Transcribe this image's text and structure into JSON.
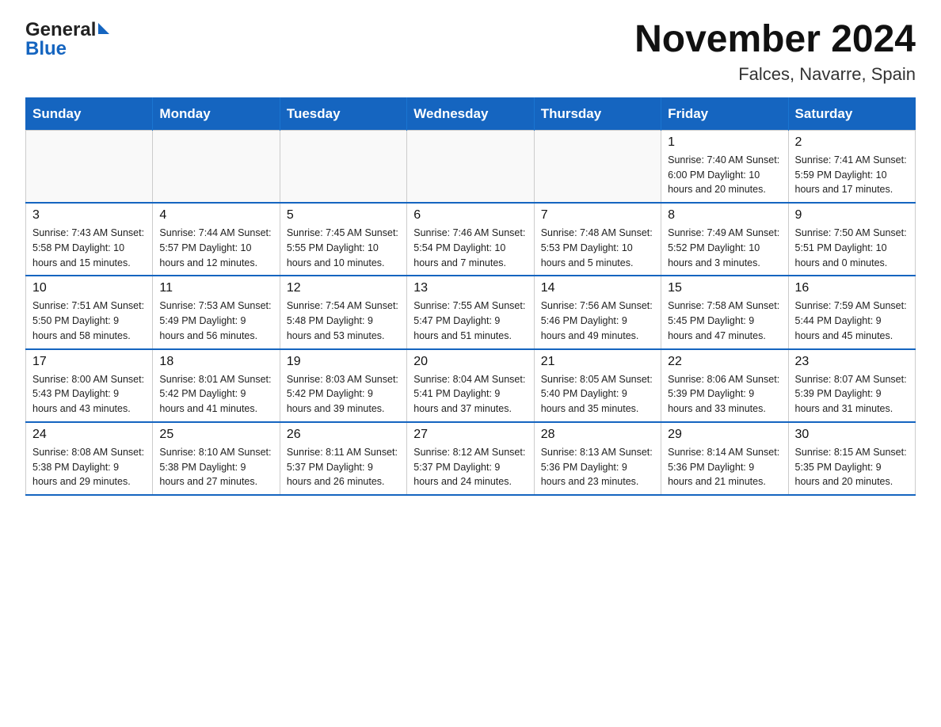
{
  "header": {
    "title": "November 2024",
    "subtitle": "Falces, Navarre, Spain",
    "logo_general": "General",
    "logo_blue": "Blue"
  },
  "calendar": {
    "days_of_week": [
      "Sunday",
      "Monday",
      "Tuesday",
      "Wednesday",
      "Thursday",
      "Friday",
      "Saturday"
    ],
    "weeks": [
      [
        {
          "day": "",
          "info": ""
        },
        {
          "day": "",
          "info": ""
        },
        {
          "day": "",
          "info": ""
        },
        {
          "day": "",
          "info": ""
        },
        {
          "day": "",
          "info": ""
        },
        {
          "day": "1",
          "info": "Sunrise: 7:40 AM\nSunset: 6:00 PM\nDaylight: 10 hours\nand 20 minutes."
        },
        {
          "day": "2",
          "info": "Sunrise: 7:41 AM\nSunset: 5:59 PM\nDaylight: 10 hours\nand 17 minutes."
        }
      ],
      [
        {
          "day": "3",
          "info": "Sunrise: 7:43 AM\nSunset: 5:58 PM\nDaylight: 10 hours\nand 15 minutes."
        },
        {
          "day": "4",
          "info": "Sunrise: 7:44 AM\nSunset: 5:57 PM\nDaylight: 10 hours\nand 12 minutes."
        },
        {
          "day": "5",
          "info": "Sunrise: 7:45 AM\nSunset: 5:55 PM\nDaylight: 10 hours\nand 10 minutes."
        },
        {
          "day": "6",
          "info": "Sunrise: 7:46 AM\nSunset: 5:54 PM\nDaylight: 10 hours\nand 7 minutes."
        },
        {
          "day": "7",
          "info": "Sunrise: 7:48 AM\nSunset: 5:53 PM\nDaylight: 10 hours\nand 5 minutes."
        },
        {
          "day": "8",
          "info": "Sunrise: 7:49 AM\nSunset: 5:52 PM\nDaylight: 10 hours\nand 3 minutes."
        },
        {
          "day": "9",
          "info": "Sunrise: 7:50 AM\nSunset: 5:51 PM\nDaylight: 10 hours\nand 0 minutes."
        }
      ],
      [
        {
          "day": "10",
          "info": "Sunrise: 7:51 AM\nSunset: 5:50 PM\nDaylight: 9 hours\nand 58 minutes."
        },
        {
          "day": "11",
          "info": "Sunrise: 7:53 AM\nSunset: 5:49 PM\nDaylight: 9 hours\nand 56 minutes."
        },
        {
          "day": "12",
          "info": "Sunrise: 7:54 AM\nSunset: 5:48 PM\nDaylight: 9 hours\nand 53 minutes."
        },
        {
          "day": "13",
          "info": "Sunrise: 7:55 AM\nSunset: 5:47 PM\nDaylight: 9 hours\nand 51 minutes."
        },
        {
          "day": "14",
          "info": "Sunrise: 7:56 AM\nSunset: 5:46 PM\nDaylight: 9 hours\nand 49 minutes."
        },
        {
          "day": "15",
          "info": "Sunrise: 7:58 AM\nSunset: 5:45 PM\nDaylight: 9 hours\nand 47 minutes."
        },
        {
          "day": "16",
          "info": "Sunrise: 7:59 AM\nSunset: 5:44 PM\nDaylight: 9 hours\nand 45 minutes."
        }
      ],
      [
        {
          "day": "17",
          "info": "Sunrise: 8:00 AM\nSunset: 5:43 PM\nDaylight: 9 hours\nand 43 minutes."
        },
        {
          "day": "18",
          "info": "Sunrise: 8:01 AM\nSunset: 5:42 PM\nDaylight: 9 hours\nand 41 minutes."
        },
        {
          "day": "19",
          "info": "Sunrise: 8:03 AM\nSunset: 5:42 PM\nDaylight: 9 hours\nand 39 minutes."
        },
        {
          "day": "20",
          "info": "Sunrise: 8:04 AM\nSunset: 5:41 PM\nDaylight: 9 hours\nand 37 minutes."
        },
        {
          "day": "21",
          "info": "Sunrise: 8:05 AM\nSunset: 5:40 PM\nDaylight: 9 hours\nand 35 minutes."
        },
        {
          "day": "22",
          "info": "Sunrise: 8:06 AM\nSunset: 5:39 PM\nDaylight: 9 hours\nand 33 minutes."
        },
        {
          "day": "23",
          "info": "Sunrise: 8:07 AM\nSunset: 5:39 PM\nDaylight: 9 hours\nand 31 minutes."
        }
      ],
      [
        {
          "day": "24",
          "info": "Sunrise: 8:08 AM\nSunset: 5:38 PM\nDaylight: 9 hours\nand 29 minutes."
        },
        {
          "day": "25",
          "info": "Sunrise: 8:10 AM\nSunset: 5:38 PM\nDaylight: 9 hours\nand 27 minutes."
        },
        {
          "day": "26",
          "info": "Sunrise: 8:11 AM\nSunset: 5:37 PM\nDaylight: 9 hours\nand 26 minutes."
        },
        {
          "day": "27",
          "info": "Sunrise: 8:12 AM\nSunset: 5:37 PM\nDaylight: 9 hours\nand 24 minutes."
        },
        {
          "day": "28",
          "info": "Sunrise: 8:13 AM\nSunset: 5:36 PM\nDaylight: 9 hours\nand 23 minutes."
        },
        {
          "day": "29",
          "info": "Sunrise: 8:14 AM\nSunset: 5:36 PM\nDaylight: 9 hours\nand 21 minutes."
        },
        {
          "day": "30",
          "info": "Sunrise: 8:15 AM\nSunset: 5:35 PM\nDaylight: 9 hours\nand 20 minutes."
        }
      ]
    ]
  }
}
